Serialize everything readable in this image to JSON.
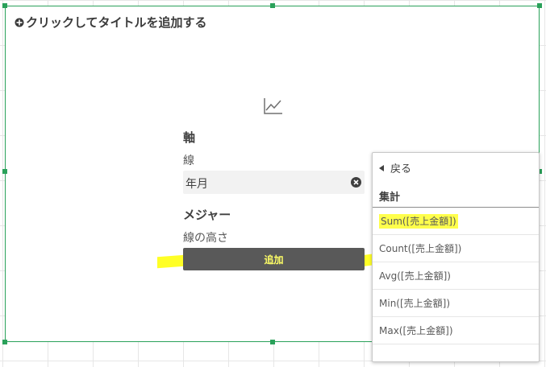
{
  "card": {
    "title": "クリックしてタイトルを追加する"
  },
  "axis": {
    "heading": "軸",
    "line_label": "線",
    "field_value": "年月"
  },
  "measure": {
    "heading": "メジャー",
    "line_height_label": "線の高さ",
    "add_button": "追加"
  },
  "panel": {
    "back": "戻る",
    "header": "集計",
    "options": [
      "Sum([売上金額])",
      "Count([売上金額])",
      "Avg([売上金額])",
      "Min([売上金額])",
      "Max([売上金額])"
    ]
  },
  "colors": {
    "selection": "#2aa15a",
    "button": "#595959",
    "highlight": "#ffff00"
  },
  "icons": [
    "plus-circle-icon",
    "line-chart-icon",
    "clear-icon",
    "back-arrow-icon"
  ]
}
